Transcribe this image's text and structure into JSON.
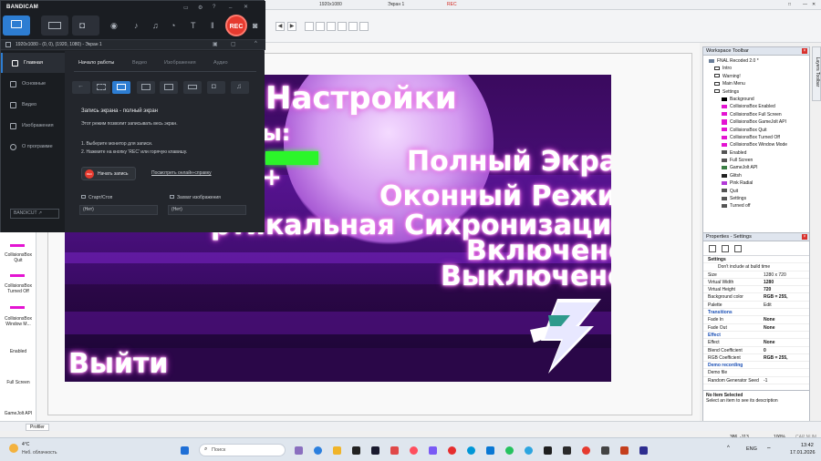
{
  "bandicam": {
    "logo": "BANDICAM",
    "rec_label": "REC",
    "info_bar": "1920x1080 - (0, 0), (1920, 1080) - Экран 1",
    "sidebar": [
      {
        "label": "Главная"
      },
      {
        "label": "Основные"
      },
      {
        "label": "Видео"
      },
      {
        "label": "Изображения"
      },
      {
        "label": "О программе"
      }
    ],
    "tabs": [
      "Начало работы",
      "Видео",
      "Изображения",
      "Аудио"
    ],
    "heading": "Запись экрана - полный экран",
    "description": "Этот режим позволит записывать весь экран.",
    "steps": [
      "1. Выберите монитор для записи.",
      "2. Нажмите на кнопку 'REC' или горячую клавишу."
    ],
    "start_button": "Начать запись",
    "start_button_badge": "REC",
    "help_link": "Посмотреть онлайн-справку",
    "hotkey_start_label": "Старт/Стоп",
    "hotkey_start_value": "(Нет)",
    "hotkey_capture_label": "Захват изображения",
    "hotkey_capture_value": "(Нет)",
    "brand": "BANDICUT ↗"
  },
  "editor_top": {
    "resolution": "1920x1080",
    "screen": "Экран 1",
    "rec": "REC"
  },
  "left_strip": {
    "items": [
      "CollisionsBox Quit",
      "CollisionsBox Turned Off",
      "CollisionsBox Window M...",
      "Enabled",
      "Full Screen",
      "GameJolt API"
    ]
  },
  "layout_text": {
    "title": "Настройки",
    "partial": "ы:",
    "plus": "+",
    "fullscreen": "Полный Экран",
    "windowed": "Оконный Режим",
    "vsync": "ртикальная Сихронизация:",
    "on": "Включено",
    "off": "Выключено",
    "exit": "Выйти"
  },
  "workspace_toolbar": {
    "title": "Workspace Toolbar",
    "tab_layers": "Layers Toolbar",
    "root": "FNAL Recoded 2.0 *",
    "items": [
      "Intro",
      "Warning!",
      "Main Menu",
      "Settings",
      "Background",
      "CollisionsBox Enabled",
      "CollisionsBox Full Screen",
      "CollisionsBox GameJolt API",
      "CollisionsBox Quit",
      "CollisionsBox Turned Off",
      "CollisionsBox Window Mode",
      "Enabled",
      "Full Screen",
      "GameJolt API",
      "Glitsh",
      "Pink Radial",
      "Quit",
      "Settings",
      "Turned off"
    ]
  },
  "properties": {
    "title": "Properties - Settings",
    "section": "Settings",
    "rows": [
      {
        "name": "Don't include at build time",
        "value": ""
      },
      {
        "name": "Size",
        "value": "1280 x 720"
      },
      {
        "name": "Virtual Width",
        "value": "1280"
      },
      {
        "name": "Virtual Height",
        "value": "720"
      },
      {
        "name": "Background color",
        "value": "RGB = 255,"
      },
      {
        "name": "Palette",
        "value": "Edit"
      },
      {
        "name": "Transitions",
        "value": ""
      },
      {
        "name": "Fade In",
        "value": "None"
      },
      {
        "name": "Fade Out",
        "value": "None"
      },
      {
        "name": "Effect",
        "value": ""
      },
      {
        "name": "Effect",
        "value": "None"
      },
      {
        "name": "Blend Coefficient",
        "value": "0"
      },
      {
        "name": "RGB Coefficient",
        "value": "RGB = 255,"
      },
      {
        "name": "Demo recording",
        "value": ""
      },
      {
        "name": "Demo file",
        "value": ""
      },
      {
        "name": "Random Generator Seed",
        "value": "-1"
      }
    ],
    "footer_title": "No Item Selected",
    "footer_text": "Select an item to see its description"
  },
  "status": {
    "profiler": "Profiler",
    "coords": "386, -113",
    "percent": "100%",
    "caps": "CAP NUM"
  },
  "taskbar": {
    "weather_temp": "4°C",
    "weather_desc": "Неб. облачность",
    "search_placeholder": "Поиск",
    "lang": "ENG",
    "time": "13:42",
    "date": "17.01.2026"
  }
}
